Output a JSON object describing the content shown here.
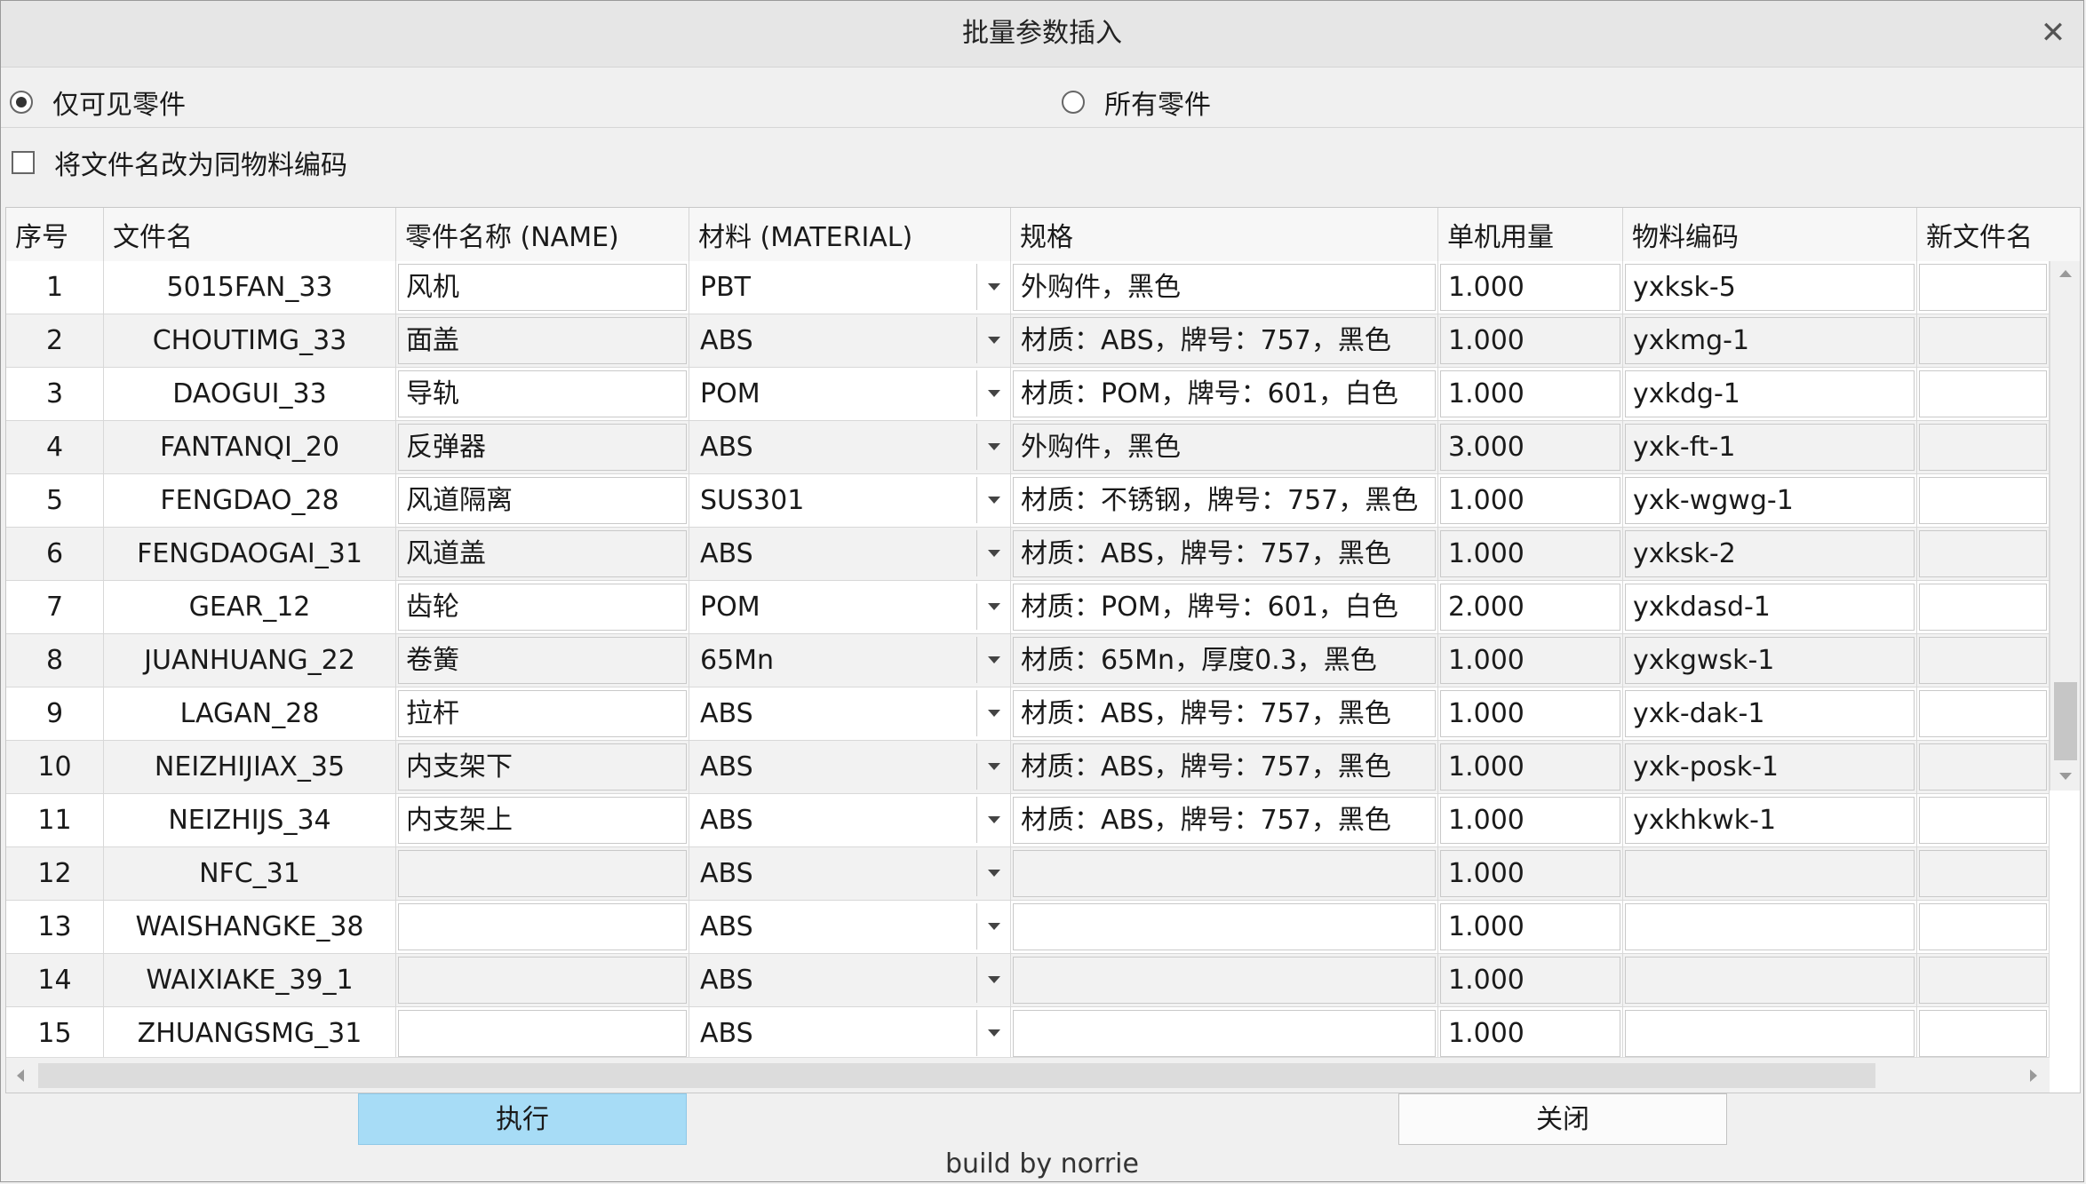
{
  "window": {
    "title": "批量参数插入"
  },
  "options": {
    "visible_only_label": "仅可见零件",
    "visible_only_selected": true,
    "all_parts_label": "所有零件",
    "all_parts_selected": false,
    "rename_label": "将文件名改为同物料编码",
    "rename_checked": false
  },
  "table": {
    "headers": {
      "index": "序号",
      "file": "文件名",
      "name": "零件名称 (NAME)",
      "material": "材料 (MATERIAL)",
      "spec": "规格",
      "qty": "单机用量",
      "code": "物料编码",
      "newfile": "新文件名"
    },
    "rows": [
      {
        "index": "1",
        "file": "5015FAN_33",
        "name": "风机",
        "material": "PBT",
        "spec": "外购件，黑色",
        "qty": "1.000",
        "code": "yxksk-5",
        "newfile": ""
      },
      {
        "index": "2",
        "file": "CHOUTIMG_33",
        "name": "面盖",
        "material": "ABS",
        "spec": "材质：ABS，牌号：757，黑色",
        "qty": "1.000",
        "code": "yxkmg-1",
        "newfile": ""
      },
      {
        "index": "3",
        "file": "DAOGUI_33",
        "name": "导轨",
        "material": "POM",
        "spec": "材质：POM，牌号：601，白色",
        "qty": "1.000",
        "code": "yxkdg-1",
        "newfile": ""
      },
      {
        "index": "4",
        "file": "FANTANQI_20",
        "name": "反弹器",
        "material": "ABS",
        "spec": "外购件，黑色",
        "qty": "3.000",
        "code": "yxk-ft-1",
        "newfile": ""
      },
      {
        "index": "5",
        "file": "FENGDAO_28",
        "name": "风道隔离",
        "material": "SUS301",
        "spec": "材质：不锈钢，牌号：757，黑色",
        "qty": "1.000",
        "code": "yxk-wgwg-1",
        "newfile": ""
      },
      {
        "index": "6",
        "file": "FENGDAOGAI_31",
        "name": "风道盖",
        "material": "ABS",
        "spec": "材质：ABS，牌号：757，黑色",
        "qty": "1.000",
        "code": "yxksk-2",
        "newfile": ""
      },
      {
        "index": "7",
        "file": "GEAR_12",
        "name": "齿轮",
        "material": "POM",
        "spec": "材质：POM，牌号：601，白色",
        "qty": "2.000",
        "code": "yxkdasd-1",
        "newfile": ""
      },
      {
        "index": "8",
        "file": "JUANHUANG_22",
        "name": "卷簧",
        "material": "65Mn",
        "spec": "材质：65Mn，厚度0.3，黑色",
        "qty": "1.000",
        "code": "yxkgwsk-1",
        "newfile": ""
      },
      {
        "index": "9",
        "file": "LAGAN_28",
        "name": "拉杆",
        "material": "ABS",
        "spec": "材质：ABS，牌号：757，黑色",
        "qty": "1.000",
        "code": "yxk-dak-1",
        "newfile": ""
      },
      {
        "index": "10",
        "file": "NEIZHIJIAX_35",
        "name": "内支架下",
        "material": "ABS",
        "spec": "材质：ABS，牌号：757，黑色",
        "qty": "1.000",
        "code": "yxk-posk-1",
        "newfile": ""
      },
      {
        "index": "11",
        "file": "NEIZHIJS_34",
        "name": "内支架上",
        "material": "ABS",
        "spec": "材质：ABS，牌号：757，黑色",
        "qty": "1.000",
        "code": "yxkhkwk-1",
        "newfile": ""
      },
      {
        "index": "12",
        "file": "NFC_31",
        "name": "",
        "material": "ABS",
        "spec": "",
        "qty": "1.000",
        "code": "",
        "newfile": ""
      },
      {
        "index": "13",
        "file": "WAISHANGKE_38",
        "name": "",
        "material": "ABS",
        "spec": "",
        "qty": "1.000",
        "code": "",
        "newfile": ""
      },
      {
        "index": "14",
        "file": "WAIXIAKE_39_1",
        "name": "",
        "material": "ABS",
        "spec": "",
        "qty": "1.000",
        "code": "",
        "newfile": ""
      },
      {
        "index": "15",
        "file": "ZHUANGSMG_31",
        "name": "",
        "material": "ABS",
        "spec": "",
        "qty": "1.000",
        "code": "",
        "newfile": ""
      }
    ]
  },
  "buttons": {
    "execute": "执行",
    "close": "关闭"
  },
  "footer": {
    "text": "build by norrie"
  },
  "colors": {
    "primary_button": "#a7dcf6",
    "window_bg": "#f0f0f0",
    "alt_row": "#f2f2f2"
  }
}
